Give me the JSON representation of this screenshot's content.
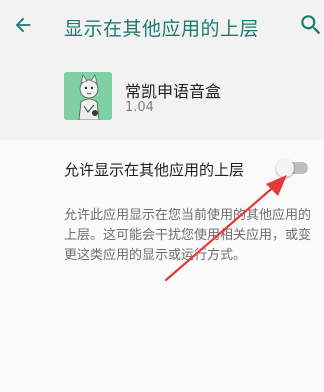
{
  "header": {
    "title": "显示在其他应用的上层",
    "back_icon": "arrow-left-icon",
    "search_icon": "search-icon",
    "accent_color": "#1a7c70"
  },
  "app": {
    "name": "常凯申语音盒",
    "version": "1.04",
    "icon": "app-icon"
  },
  "setting": {
    "label": "允许显示在其他应用的上层",
    "enabled": false
  },
  "description": "允许此应用显示在您当前使用的其他应用的上层。这可能会干扰您使用相关应用，或变更这类应用的显示或运行方式。",
  "annotation": {
    "arrow_color": "#e53935"
  }
}
